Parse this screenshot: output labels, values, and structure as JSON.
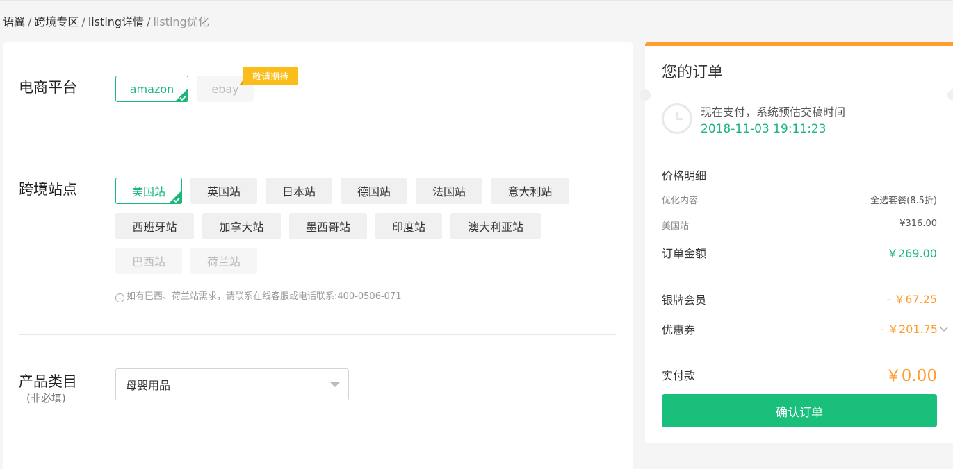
{
  "breadcrumb": {
    "items": [
      "语翼",
      "跨境专区",
      "listing详情"
    ],
    "current": "listing优化",
    "separator": "/"
  },
  "platform": {
    "label": "电商平台",
    "options": [
      "amazon",
      "ebay"
    ],
    "selected": "amazon",
    "coming_soon_badge": "敬请期待"
  },
  "sites": {
    "label": "跨境站点",
    "row1": [
      "美国站",
      "英国站",
      "日本站",
      "德国站",
      "法国站",
      "意大利站"
    ],
    "row2": [
      "西班牙站",
      "加拿大站",
      "墨西哥站",
      "印度站",
      "澳大利亚站"
    ],
    "row3_disabled": [
      "巴西站",
      "荷兰站"
    ],
    "selected": "美国站",
    "hint_icon": "info-icon",
    "hint": "如有巴西、荷兰站需求，请联系在线客服或电话联系:400-0506-071"
  },
  "category": {
    "label": "产品类目",
    "sub_label": "(非必填)",
    "selected_value": "母婴用品"
  },
  "order": {
    "title": "您的订单",
    "pay_note": "现在支付，系统预估交稿时间",
    "pay_time": "2018-11-03 19:11:23",
    "price_detail_title": "价格明细",
    "content_label": "优化内容",
    "content_value": "全选套餐(8.5折)",
    "site_label": "美国站",
    "site_value": "¥316.00",
    "amount_label": "订单金额",
    "amount_value": "￥269.00",
    "member_label": "银牌会员",
    "member_value": "- ￥67.25",
    "coupon_label": "优惠券",
    "coupon_value": "- ￥201.75",
    "paid_label": "实付款",
    "paid_value": "￥0.00",
    "confirm_button": "确认订单"
  },
  "colors": {
    "accent_green": "#1ab67b",
    "accent_orange": "#ff9d2e",
    "badge_yellow": "#fbbd19"
  }
}
